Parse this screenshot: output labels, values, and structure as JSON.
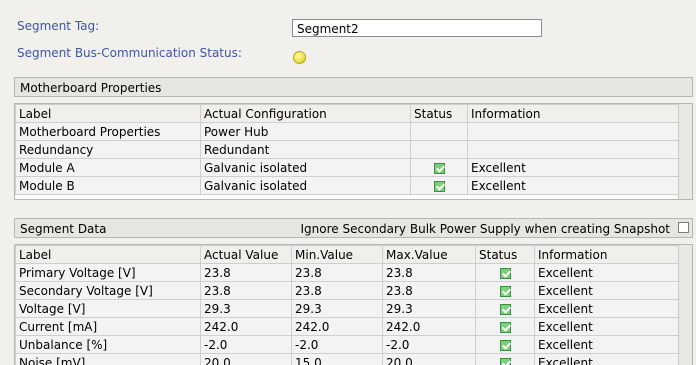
{
  "segment": {
    "tag_label": "Segment Tag:",
    "tag_value": "Segment2",
    "status_label": "Segment Bus-Communication Status:",
    "status_color": "#f0e34a"
  },
  "motherboard": {
    "title": "Motherboard Properties",
    "columns": [
      "Label",
      "Actual Configuration",
      "Status",
      "Information"
    ],
    "rows": [
      {
        "label": "Motherboard Properties",
        "config": "Power Hub",
        "status": "",
        "info": ""
      },
      {
        "label": "Redundancy",
        "config": "Redundant",
        "status": "",
        "info": ""
      },
      {
        "label": "Module A",
        "config": "Galvanic isolated",
        "status": "ok",
        "info": "Excellent"
      },
      {
        "label": "Module B",
        "config": "Galvanic isolated",
        "status": "ok",
        "info": "Excellent"
      }
    ]
  },
  "segment_data": {
    "title": "Segment Data",
    "ignore_option_label": "Ignore Secondary Bulk Power Supply when creating Snapshot",
    "ignore_option_checked": false,
    "columns": [
      "Label",
      "Actual Value",
      "Min.Value",
      "Max.Value",
      "Status",
      "Information"
    ],
    "rows": [
      {
        "label": "Primary Voltage [V]",
        "actual": "23.8",
        "min": "23.8",
        "max": "23.8",
        "status": "ok",
        "info": "Excellent"
      },
      {
        "label": "Secondary Voltage [V]",
        "actual": "23.8",
        "min": "23.8",
        "max": "23.8",
        "status": "ok",
        "info": "Excellent"
      },
      {
        "label": "Voltage [V]",
        "actual": "29.3",
        "min": "29.3",
        "max": "29.3",
        "status": "ok",
        "info": "Excellent"
      },
      {
        "label": "Current [mA]",
        "actual": "242.0",
        "min": "242.0",
        "max": "242.0",
        "status": "ok",
        "info": "Excellent"
      },
      {
        "label": "Unbalance [%]",
        "actual": "-2.0",
        "min": "-2.0",
        "max": "-2.0",
        "status": "ok",
        "info": "Excellent"
      },
      {
        "label": "Noise [mV]",
        "actual": "20.0",
        "min": "15.0",
        "max": "20.0",
        "status": "ok",
        "info": "Excellent"
      }
    ]
  }
}
